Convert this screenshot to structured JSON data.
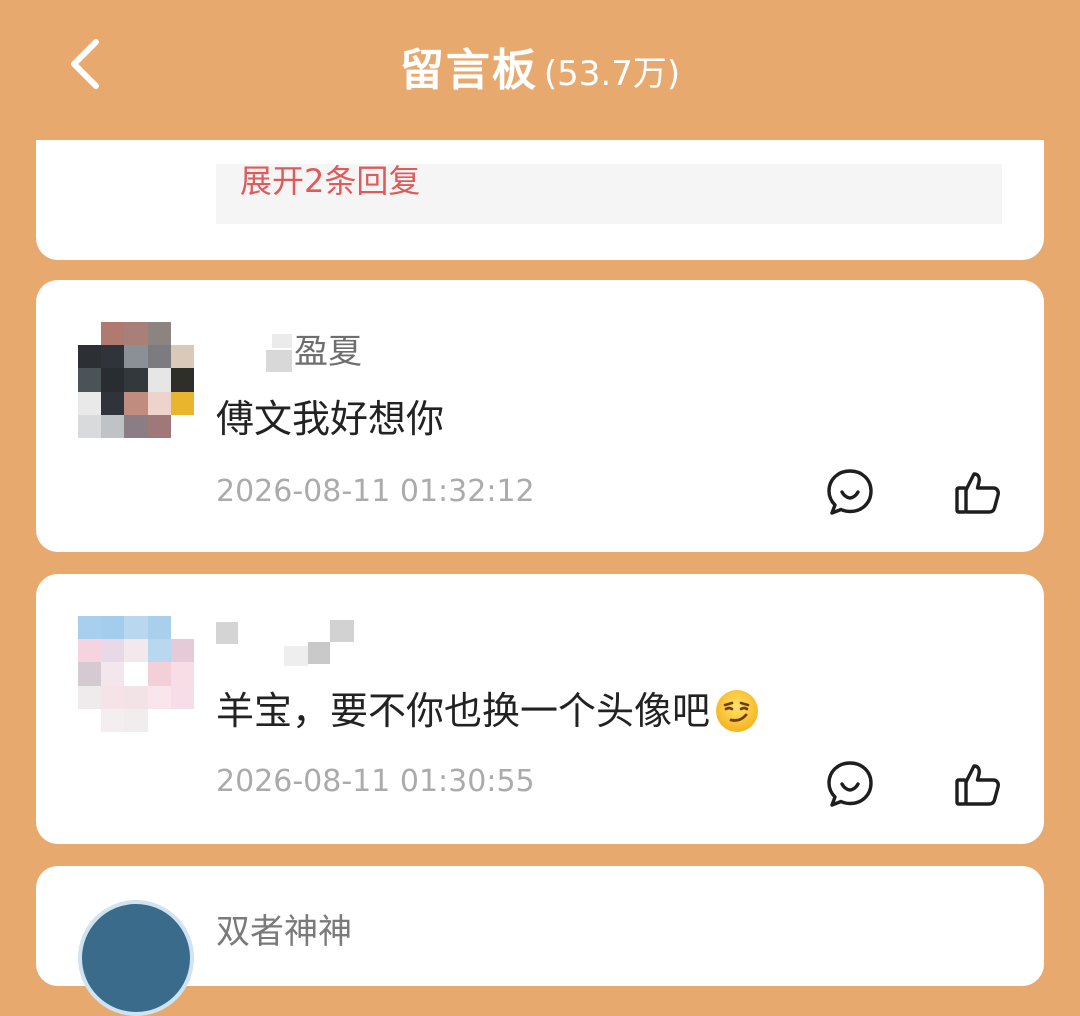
{
  "header": {
    "title": "留言板",
    "count": "(53.7万)"
  },
  "top_card": {
    "reply_link": "展开2条回复"
  },
  "comments": [
    {
      "username": "盈夏",
      "content": "傅文我好想你",
      "time": "2026-08-11 01:32:12"
    },
    {
      "username": "",
      "content": "羊宝，要不你也换一个头像吧",
      "emoji": "smirking-face-emoji",
      "time": "2026-08-11 01:30:55"
    },
    {
      "username": "双者神神"
    }
  ],
  "icons": {
    "back": "chevron-left-icon",
    "comment": "comment-bubble-icon",
    "like": "thumbs-up-icon"
  },
  "colors": {
    "background": "#E8A96F",
    "card": "#FFFFFF",
    "reply_link": "#E05A5A",
    "time": "#ABABAB"
  }
}
